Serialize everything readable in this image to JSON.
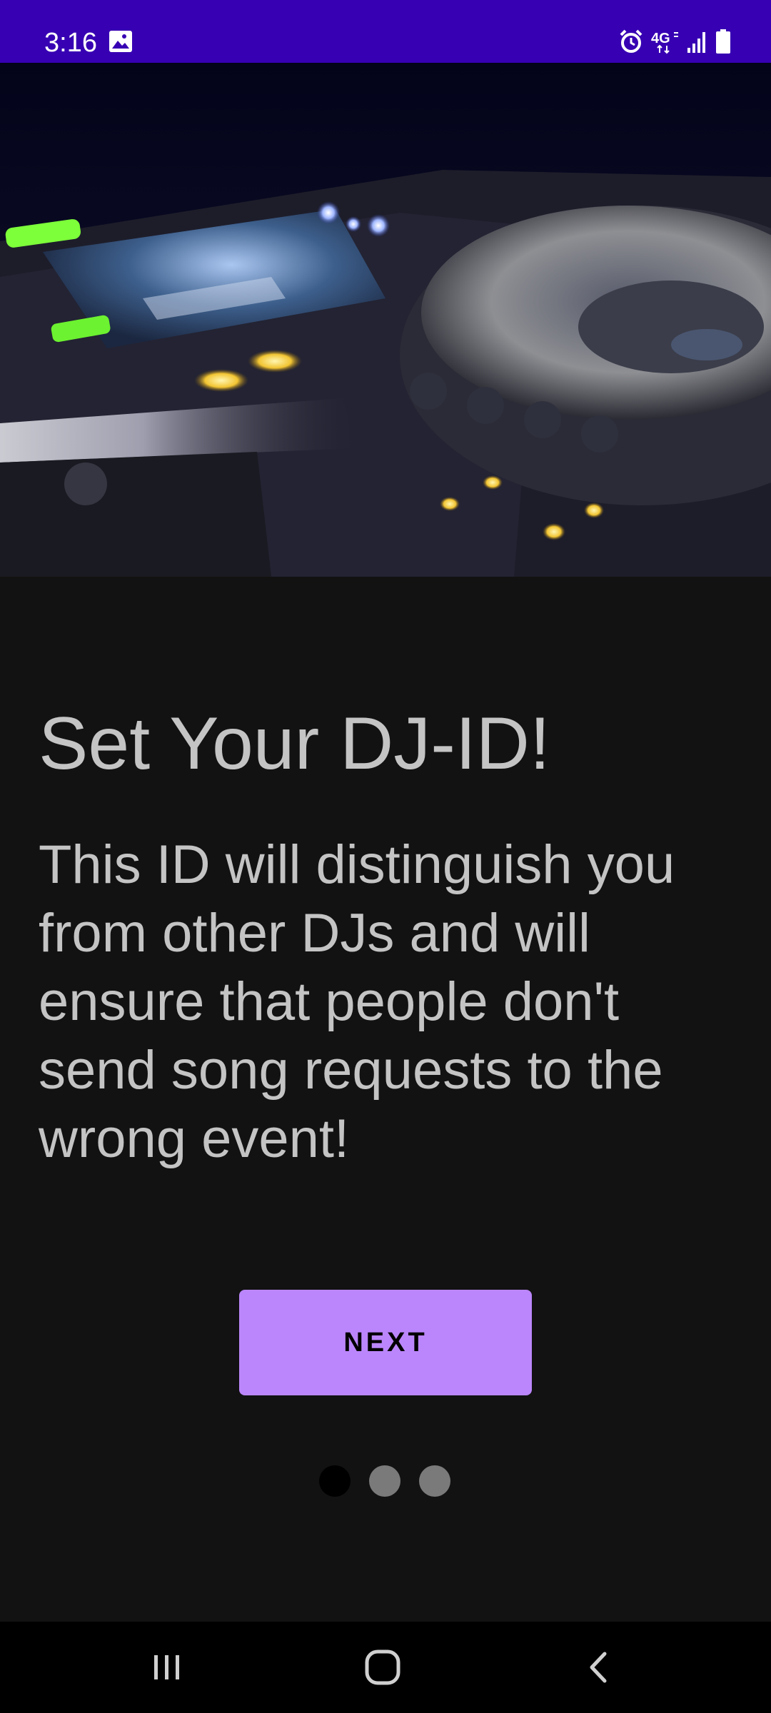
{
  "status_bar": {
    "time": "3:16",
    "background": "#3700b3",
    "left_icons": [
      "image-icon"
    ],
    "right_icons": [
      "alarm-icon",
      "lte-4g-icon",
      "signal-icon",
      "battery-icon"
    ],
    "network_label": "4G"
  },
  "hero": {
    "image": "dj-turntable-photo"
  },
  "onboarding": {
    "title": "Set Your DJ-ID!",
    "description": "This ID will distinguish you from other DJs and will ensure that people don't send song requests to the wrong event!",
    "next_label": "NEXT",
    "page_count": 3,
    "current_page": 1,
    "dots": [
      {
        "state": "active",
        "color": "#000000"
      },
      {
        "state": "inactive",
        "color": "#7a7a7a"
      },
      {
        "state": "inactive",
        "color": "#7a7a7a"
      }
    ]
  },
  "colors": {
    "background": "#121212",
    "accent": "#bb86fc",
    "text": "#c4c4c4"
  },
  "nav_bar": {
    "buttons": [
      "recents-icon",
      "home-icon",
      "back-icon"
    ]
  }
}
